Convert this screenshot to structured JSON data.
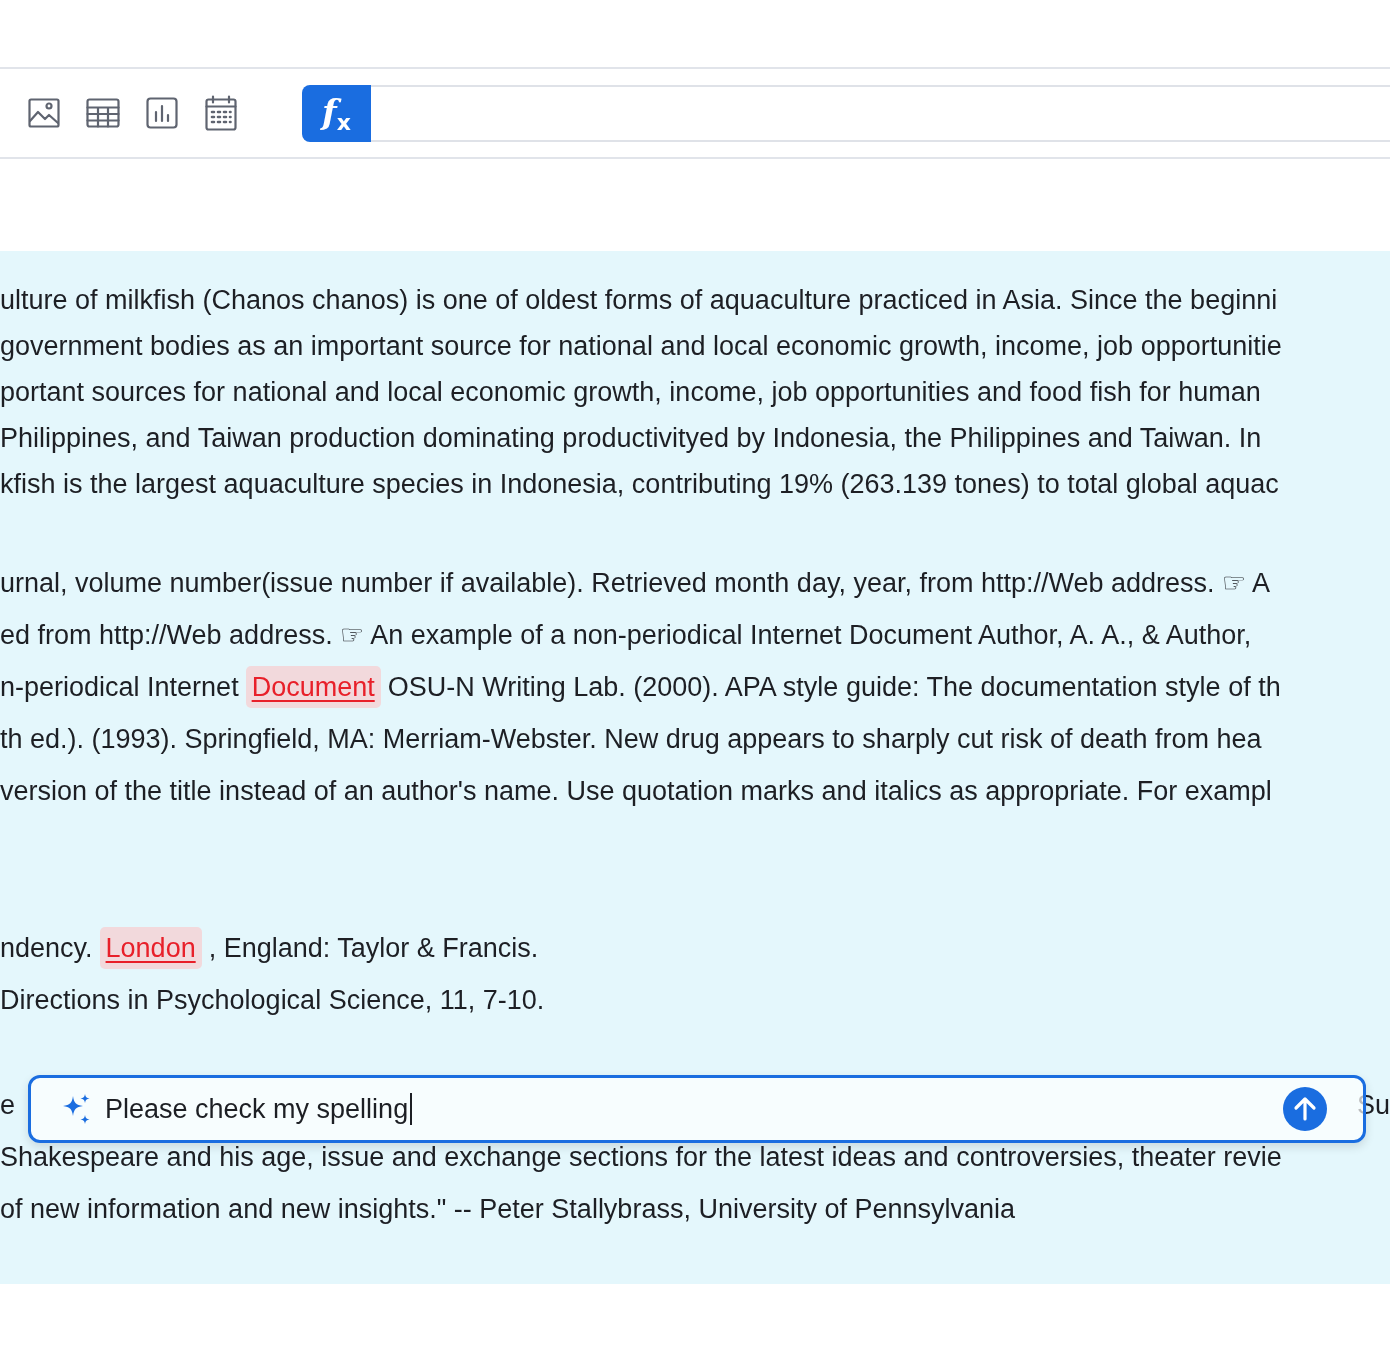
{
  "toolbar": {
    "tools": [
      {
        "kind": "image"
      },
      {
        "kind": "table"
      },
      {
        "kind": "chart"
      },
      {
        "kind": "calendar"
      }
    ],
    "formula_button": {
      "label": "f$_{x}$"
    }
  },
  "document": {
    "paragraphs": [
      {
        "lines": [
          [
            {
              "kind": "text",
              "text": "ulture of milkfish (Chanos chanos) is one of oldest forms of aquaculture practiced in Asia. Since the beginni"
            }
          ],
          [
            {
              "kind": "text",
              "text": "government bodies as an important source for national and local economic growth, income, job opportunitie"
            }
          ],
          [
            {
              "kind": "text",
              "text": "portant sources for national and local economic growth, income, job opportunities and food fish for human"
            }
          ],
          [
            {
              "kind": "text",
              "text": "Philippines, and Taiwan production dominating productivityed by Indonesia, the Philippines and Taiwan. In"
            }
          ],
          [
            {
              "kind": "text",
              "text": "kfish is the largest aquaculture species in Indonesia, contributing 19% (263.139 tones) to total global aquac"
            }
          ]
        ]
      },
      {
        "lines": [
          [
            {
              "kind": "text",
              "text": "urnal, volume number(issue number if available). Retrieved month day, year, from http://Web address. ☞ A"
            }
          ],
          [
            {
              "kind": "text",
              "text": "ed from http://Web address. ☞ An example of a non-periodical Internet Document Author, A. A., & Author,"
            }
          ],
          [
            {
              "kind": "text",
              "text": "n-periodical Internet"
            },
            {
              "kind": "misspelled",
              "text": "Document"
            },
            {
              "kind": "text",
              "text": "OSU-N Writing Lab. (2000). APA style guide: The documentation style of th"
            }
          ],
          [
            {
              "kind": "text",
              "text": "th ed.). (1993). Springfield, MA: Merriam-Webster. New drug appears to sharply cut risk of death from hea"
            }
          ],
          [
            {
              "kind": "text",
              "text": "version of the title instead of an author's name. Use quotation marks and italics as appropriate. For exampl"
            }
          ]
        ]
      },
      {
        "lines": [
          [
            {
              "kind": "text",
              "text": "ndency."
            },
            {
              "kind": "misspelled",
              "text": "London"
            },
            {
              "kind": "text",
              "text": ", England: Taylor & Francis."
            }
          ],
          [
            {
              "kind": "text",
              "text": "Directions in Psychological Science, 11, 7-10."
            }
          ]
        ]
      },
      {
        "lines": [
          [
            {
              "kind": "text",
              "text": "e"
            },
            {
              "kind": "text_end",
              "text": "Su"
            }
          ],
          [
            {
              "kind": "text",
              "text": "Shakespeare and his age, issue and exchange sections for the latest ideas and controversies, theater revie"
            }
          ],
          [
            {
              "kind": "text",
              "text": "of new information and new insights.\" -- Peter Stallybrass, University of Pennsylvania"
            }
          ]
        ]
      }
    ]
  },
  "prompt": {
    "value": "Please check my spelling"
  }
}
